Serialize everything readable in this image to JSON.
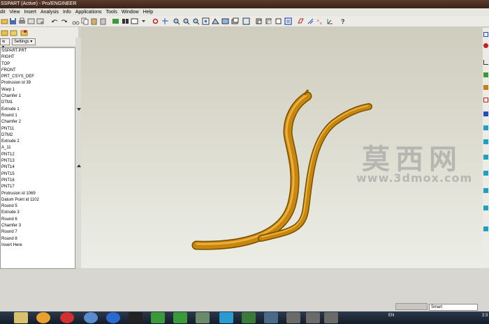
{
  "window": {
    "title": "SSPART (Active) - Pro/ENGINEER"
  },
  "menu": [
    "dit",
    "View",
    "Insert",
    "Analysis",
    "Info",
    "Applications",
    "Tools",
    "Window",
    "Help"
  ],
  "nav": {
    "show_label": "w ▾",
    "settings_label": "Settings ▾"
  },
  "tree": {
    "items": [
      "SSPART.PRT",
      "RIGHT",
      "TOP",
      "FRONT",
      "PRT_CSYS_DEF",
      "Protrusion id 39",
      "Warp 1",
      "Chamfer 1",
      "DTM1",
      "Extrude 1",
      "Round 1",
      "Chamfer 2",
      "PNT11",
      "DTM2",
      "Extrude 2",
      "A_11",
      "PNT12",
      "PNT13",
      "PNT14",
      "PNT15",
      "PNT16",
      "PNT17",
      "Protrusion id 1069",
      "Datum Point id 1102",
      "Round 5",
      "Extrude 3",
      "Round 6",
      "Chamfer 3",
      "Round 7",
      "Round 8",
      "Insert Here"
    ]
  },
  "watermark": {
    "cn": "莫西网",
    "url": "www.3dmox.com"
  },
  "status": {
    "filter": "Smart"
  },
  "tray": {
    "lang": "EN",
    "time": "2:3"
  },
  "colors": {
    "model": "#c8860a",
    "viewport_top": "#cfcdbe",
    "viewport_bottom": "#eceee6"
  }
}
